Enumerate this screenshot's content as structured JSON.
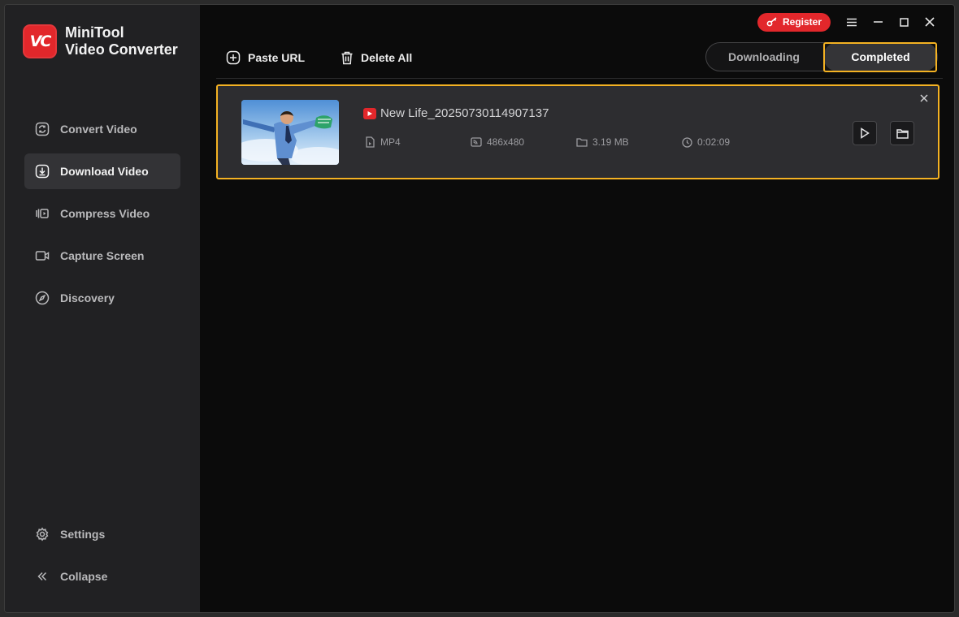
{
  "app": {
    "name_line1": "MiniTool",
    "name_line2": "Video Converter",
    "logo_text": "VC",
    "accent_color": "#e2272b",
    "highlight_color": "#f4b223"
  },
  "sidebar": {
    "items": [
      {
        "label": "Convert Video",
        "icon": "convert-icon"
      },
      {
        "label": "Download Video",
        "icon": "download-icon",
        "active": true
      },
      {
        "label": "Compress Video",
        "icon": "compress-icon"
      },
      {
        "label": "Capture Screen",
        "icon": "camera-icon"
      },
      {
        "label": "Discovery",
        "icon": "compass-icon"
      }
    ],
    "bottom": [
      {
        "label": "Settings",
        "icon": "gear-icon"
      },
      {
        "label": "Collapse",
        "icon": "double-chevron-left-icon"
      }
    ]
  },
  "titlebar": {
    "register_label": "Register"
  },
  "toolbar": {
    "paste_url_label": "Paste URL",
    "delete_all_label": "Delete All"
  },
  "tabs": {
    "downloading_label": "Downloading",
    "completed_label": "Completed",
    "selected": "Completed"
  },
  "downloads": [
    {
      "title": "New Life_20250730114907137",
      "format": "MP4",
      "resolution": "486x480",
      "size": "3.19 MB",
      "duration": "0:02:09",
      "source_icon": "youtube-icon"
    }
  ]
}
